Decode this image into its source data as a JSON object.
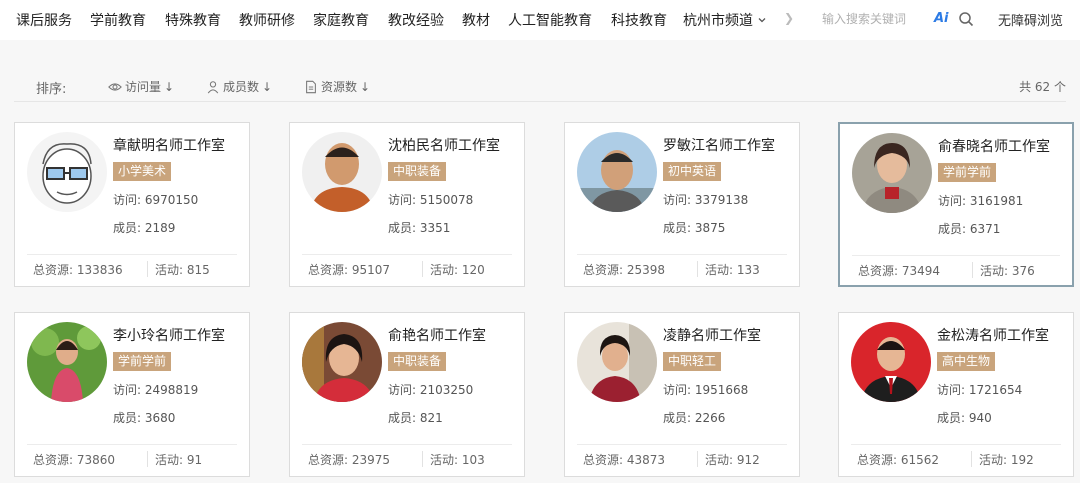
{
  "nav": {
    "items": [
      "课后服务",
      "学前教育",
      "特殊教育",
      "教师研修",
      "家庭教育",
      "教改经验",
      "教材",
      "人工智能教育",
      "科技教育"
    ],
    "city": "杭州市频道",
    "search_placeholder": "输入搜索关键词",
    "ai_label": "Ai",
    "accessibility": "无障碍浏览"
  },
  "sort": {
    "label": "排序:",
    "options": [
      "访问量",
      "成员数",
      "资源数"
    ],
    "total": "共 62 个"
  },
  "cards": [
    {
      "title": "章献明名师工作室",
      "tag": "小学美术",
      "visit": "访问: 6970150",
      "member": "成员: 2189",
      "resources": "总资源: 133836",
      "activity": "活动: 815",
      "active": false
    },
    {
      "title": "沈柏民名师工作室",
      "tag": "中职装备",
      "visit": "访问: 5150078",
      "member": "成员: 3351",
      "resources": "总资源: 95107",
      "activity": "活动: 120",
      "active": false
    },
    {
      "title": "罗敏江名师工作室",
      "tag": "初中英语",
      "visit": "访问: 3379138",
      "member": "成员: 3875",
      "resources": "总资源: 25398",
      "activity": "活动: 133",
      "active": false
    },
    {
      "title": "俞春晓名师工作室",
      "tag": "学前学前",
      "visit": "访问: 3161981",
      "member": "成员: 6371",
      "resources": "总资源: 73494",
      "activity": "活动: 376",
      "active": true
    },
    {
      "title": "李小玲名师工作室",
      "tag": "学前学前",
      "visit": "访问: 2498819",
      "member": "成员: 3680",
      "resources": "总资源: 73860",
      "activity": "活动: 91",
      "active": false
    },
    {
      "title": "俞艳名师工作室",
      "tag": "中职装备",
      "visit": "访问: 2103250",
      "member": "成员: 821",
      "resources": "总资源: 23975",
      "activity": "活动: 103",
      "active": false
    },
    {
      "title": "凌静名师工作室",
      "tag": "中职轻工",
      "visit": "访问: 1951668",
      "member": "成员: 2266",
      "resources": "总资源: 43873",
      "activity": "活动: 912",
      "active": false
    },
    {
      "title": "金松涛名师工作室",
      "tag": "高中生物",
      "visit": "访问: 1721654",
      "member": "成员: 940",
      "resources": "总资源: 61562",
      "activity": "活动: 192",
      "active": false
    }
  ],
  "colors": {
    "tag": "#c9a47c",
    "active_border": "#8aa1ad",
    "accent": "#2c7be5"
  }
}
